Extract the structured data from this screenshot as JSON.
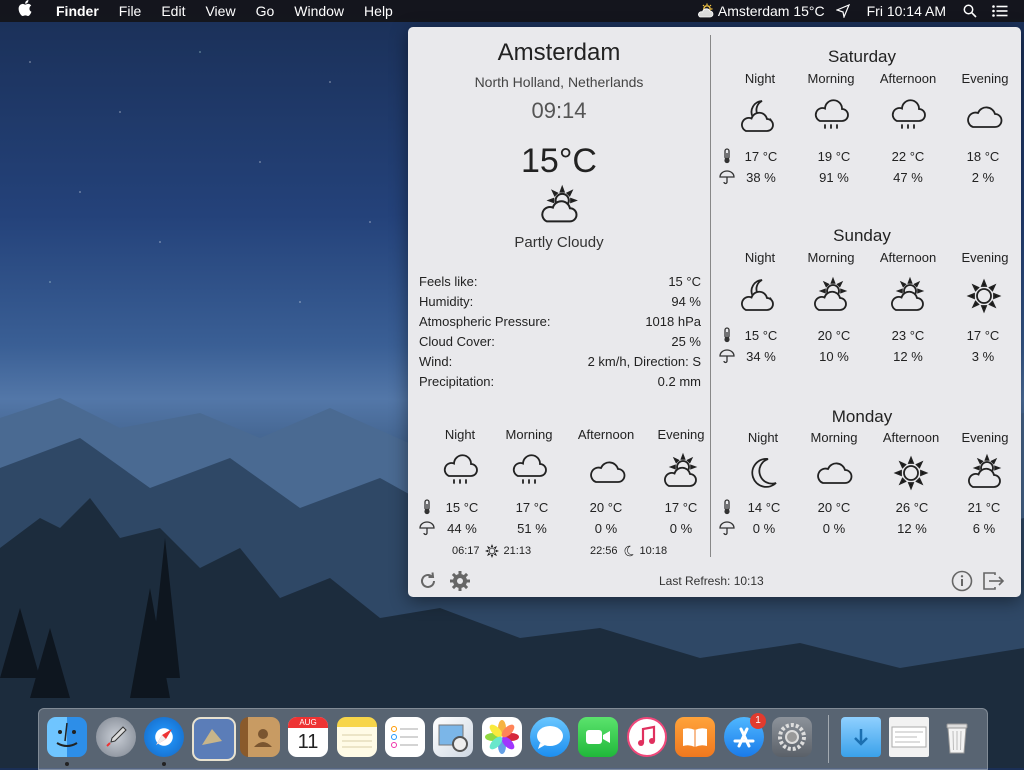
{
  "menubar": {
    "app": "Finder",
    "items": [
      "File",
      "Edit",
      "View",
      "Go",
      "Window",
      "Help"
    ],
    "weather_status": "Amsterdam 15°C",
    "clock": "Fri 10:14 AM"
  },
  "weather": {
    "city": "Amsterdam",
    "region": "North Holland, Netherlands",
    "local_time": "09:14",
    "temperature": "15°C",
    "condition": "Partly Cloudy",
    "condition_icon": "partly-cloudy-icon",
    "details": [
      {
        "label": "Feels like:",
        "value": "15 °C"
      },
      {
        "label": "Humidity:",
        "value": "94 %"
      },
      {
        "label": "Atmospheric Pressure:",
        "value": "1018 hPa"
      },
      {
        "label": "Cloud Cover:",
        "value": "25 %"
      },
      {
        "label": "Wind:",
        "value": "2 km/h, Direction: S"
      },
      {
        "label": "Precipitation:",
        "value": "0.2 mm"
      }
    ],
    "today": [
      {
        "label": "Night",
        "icon": "rain-icon",
        "temp": "15 °C",
        "precip": "44 %"
      },
      {
        "label": "Morning",
        "icon": "rain-icon",
        "temp": "17 °C",
        "precip": "51 %"
      },
      {
        "label": "Afternoon",
        "icon": "cloud-icon",
        "temp": "20 °C",
        "precip": "0 %"
      },
      {
        "label": "Evening",
        "icon": "partly-cloudy-icon",
        "temp": "17 °C",
        "precip": "0 %"
      }
    ],
    "sunrise": "06:17",
    "sunset": "21:13",
    "moonrise": "22:56",
    "moonset": "10:18",
    "last_refresh": "Last Refresh: 10:13",
    "days": [
      {
        "name": "Saturday",
        "periods": [
          {
            "label": "Night",
            "icon": "moon-cloud-icon",
            "temp": "17 °C",
            "precip": "38 %"
          },
          {
            "label": "Morning",
            "icon": "rain-icon",
            "temp": "19 °C",
            "precip": "91 %"
          },
          {
            "label": "Afternoon",
            "icon": "rain-icon",
            "temp": "22 °C",
            "precip": "47 %"
          },
          {
            "label": "Evening",
            "icon": "cloud-icon",
            "temp": "18 °C",
            "precip": "2 %"
          }
        ]
      },
      {
        "name": "Sunday",
        "periods": [
          {
            "label": "Night",
            "icon": "moon-cloud-icon",
            "temp": "15 °C",
            "precip": "34 %"
          },
          {
            "label": "Morning",
            "icon": "partly-cloudy-icon",
            "temp": "20 °C",
            "precip": "10 %"
          },
          {
            "label": "Afternoon",
            "icon": "partly-cloudy-icon",
            "temp": "23 °C",
            "precip": "12 %"
          },
          {
            "label": "Evening",
            "icon": "sun-icon",
            "temp": "17 °C",
            "precip": "3 %"
          }
        ]
      },
      {
        "name": "Monday",
        "periods": [
          {
            "label": "Night",
            "icon": "moon-icon",
            "temp": "14 °C",
            "precip": "0 %"
          },
          {
            "label": "Morning",
            "icon": "cloud-icon",
            "temp": "20 °C",
            "precip": "0 %"
          },
          {
            "label": "Afternoon",
            "icon": "sun-icon",
            "temp": "26 °C",
            "precip": "12 %"
          },
          {
            "label": "Evening",
            "icon": "partly-cloudy-icon",
            "temp": "21 °C",
            "precip": "6 %"
          }
        ]
      }
    ]
  },
  "dock": {
    "calendar_month": "AUG",
    "calendar_day": "11",
    "app_store_badge": "1",
    "apps": [
      "finder",
      "launchpad",
      "safari",
      "mail",
      "contacts",
      "calendar",
      "notes",
      "reminders",
      "preview",
      "photos",
      "messages",
      "facetime",
      "itunes",
      "ibooks",
      "app-store",
      "system-preferences",
      "downloads",
      "documents",
      "trash"
    ]
  }
}
